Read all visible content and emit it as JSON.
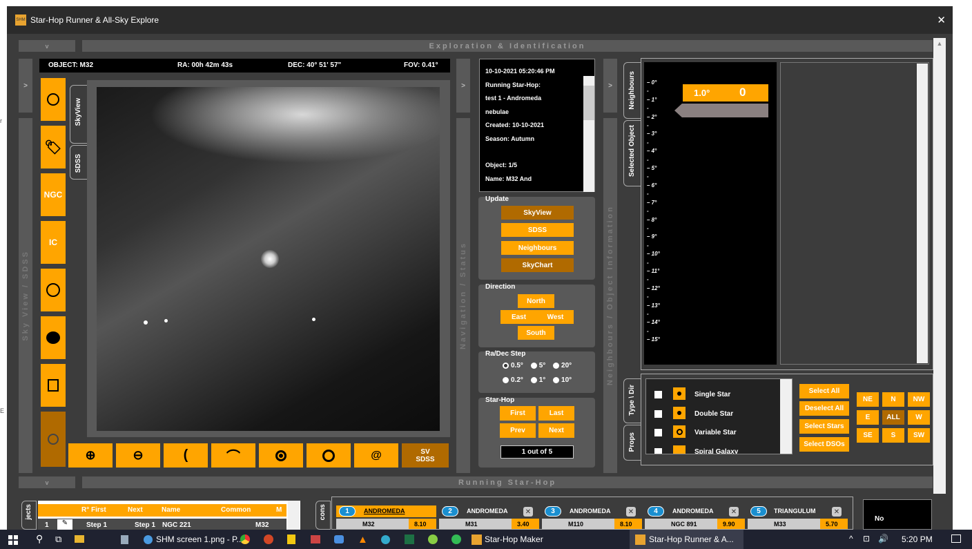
{
  "window": {
    "title": "Star-Hop Runner & All-Sky Explore",
    "close": "✕"
  },
  "sections": {
    "top": "Exploration & Identification",
    "bottom": "Running Star-Hop",
    "collapse_glyph": "v",
    "expand_glyph": ">"
  },
  "side_labels": {
    "skyview": "Sky View / SDSS",
    "nav": "Navigation / Status",
    "neighbours": "Neighbours / Object Information"
  },
  "info": {
    "object": "OBJECT: M32",
    "ra": "RA: 00h 42m 43s",
    "dec": "DEC: 40° 51' 57\"",
    "fov": "FOV: 0.41°"
  },
  "left_tools": {
    "ngc": "NGC",
    "ic": "IC"
  },
  "view_tabs": {
    "skyview": "SkyView",
    "sdss": "SDSS"
  },
  "bottom_tools": {
    "sv": "SV",
    "sdss": "SDSS"
  },
  "status": {
    "lines": [
      "10-10-2021 05:20:46 PM",
      "",
      "Running Star-Hop:",
      "test 1 - Andromeda",
      "nebulae",
      "Created: 10-10-2021",
      "Season: Autumn",
      "",
      "Object: 1/5",
      "Name: M32 And"
    ]
  },
  "update": {
    "title": "Update",
    "skyview": "SkyView",
    "sdss": "SDSS",
    "neighbours": "Neighbours",
    "skychart": "SkyChart"
  },
  "direction": {
    "title": "Direction",
    "north": "North",
    "east": "East",
    "west": "West",
    "south": "South"
  },
  "radec": {
    "title": "Ra/Dec Step",
    "r1": [
      "0.5°",
      "5°",
      "20°"
    ],
    "r2": [
      "0.2°",
      "1°",
      "10°"
    ]
  },
  "starhop": {
    "title": "Star-Hop",
    "first": "First",
    "last": "Last",
    "prev": "Prev",
    "next": "Next",
    "counter": "1 out of 5"
  },
  "right_tabs": {
    "neighbours": "Neighbours",
    "selected": "Selected Object",
    "type": "Type \\ Dir",
    "props": "Props"
  },
  "scale": {
    "ticks": [
      "0°",
      "1°",
      "2°",
      "3°",
      "4°",
      "5°",
      "6°",
      "7°",
      "8°",
      "9°",
      "10°",
      "11°",
      "12°",
      "13°",
      "14°",
      "15°"
    ],
    "value": "1.0°",
    "count": "0"
  },
  "types": {
    "items": [
      "Single Star",
      "Double Star",
      "Variable Star",
      "Spiral Galaxy"
    ]
  },
  "select_buttons": {
    "all": "Select All",
    "deselect": "Deselect All",
    "stars": "Select Stars",
    "dsos": "Select DSOs"
  },
  "dirs": {
    "row1": [
      "NE",
      "N",
      "NW"
    ],
    "row2": [
      "E",
      "ALL",
      "W"
    ],
    "row3": [
      "SE",
      "S",
      "SW"
    ]
  },
  "table": {
    "tab": "jects",
    "headers": [
      "R° First",
      "Next",
      "Name",
      "Common",
      "M"
    ],
    "row": {
      "num": "1",
      "first": "Step 1",
      "next": "Step 1",
      "name": "NGC 221",
      "common": "M32"
    }
  },
  "hops": {
    "tab": "cons",
    "items": [
      {
        "n": "1",
        "con": "ANDROMEDA",
        "obj": "M32",
        "mag": "8.10"
      },
      {
        "n": "2",
        "con": "ANDROMEDA",
        "obj": "M31",
        "mag": "3.40"
      },
      {
        "n": "3",
        "con": "ANDROMEDA",
        "obj": "M110",
        "mag": "8.10"
      },
      {
        "n": "4",
        "con": "ANDROMEDA",
        "obj": "NGC 891",
        "mag": "9.90"
      },
      {
        "n": "5",
        "con": "TRIANGULUM",
        "obj": "M33",
        "mag": "5.70"
      }
    ]
  },
  "no_label": "No",
  "taskbar": {
    "items": [
      "SHM screen 1.png - P...",
      "Star-Hop Maker",
      "Star-Hop Runner & A..."
    ],
    "time": "5:20 PM"
  },
  "colors": {
    "accent": "#ffa500",
    "dark_accent": "#b06a00",
    "panel": "#595959",
    "bg": "#3c3c3c"
  }
}
